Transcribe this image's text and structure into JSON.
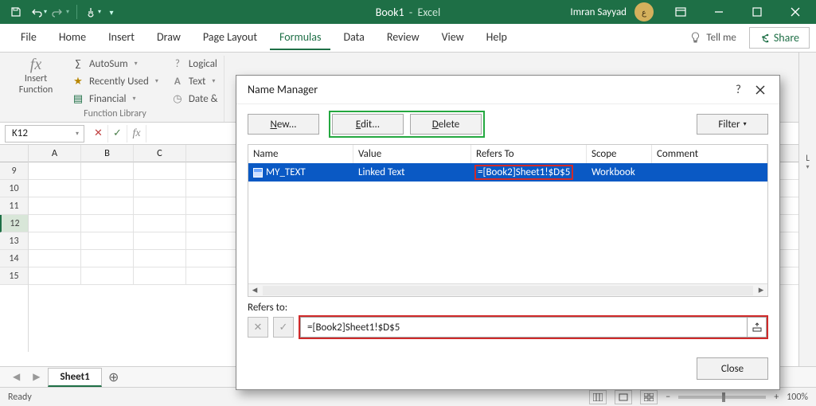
{
  "title": {
    "doc": "Book1",
    "app": "Excel"
  },
  "user": "Imran Sayyad",
  "tabs": [
    "File",
    "Home",
    "Insert",
    "Draw",
    "Page Layout",
    "Formulas",
    "Data",
    "Review",
    "View",
    "Help"
  ],
  "active_tab": "Formulas",
  "tellme": "Tell me",
  "share": "Share",
  "ribbon": {
    "insert_fn": [
      "Insert",
      "Function"
    ],
    "items1": [
      "AutoSum",
      "Recently Used",
      "Financial"
    ],
    "items2": [
      "Logical",
      "Text",
      "Date &"
    ],
    "group_label": "Function Library"
  },
  "namebox": "K12",
  "cols": [
    "A",
    "B",
    "C"
  ],
  "rows": [
    "9",
    "10",
    "11",
    "12",
    "13",
    "14",
    "15"
  ],
  "selected_row": "12",
  "sheet": "Sheet1",
  "status": "Ready",
  "zoom": "100%",
  "dialog": {
    "title": "Name Manager",
    "btn_new": "New...",
    "btn_edit": "Edit...",
    "btn_delete": "Delete",
    "btn_filter": "Filter",
    "headers": {
      "name": "Name",
      "value": "Value",
      "refers": "Refers To",
      "scope": "Scope",
      "comment": "Comment"
    },
    "row": {
      "name": "MY_TEXT",
      "value": "Linked Text",
      "refers": "=[Book2]Sheet1!$D$5",
      "scope": "Workbook",
      "comment": ""
    },
    "refers_label": "Refers to:",
    "refers_value": "=[Book2]Sheet1!$D$5",
    "close": "Close"
  },
  "right_col_label": "L"
}
